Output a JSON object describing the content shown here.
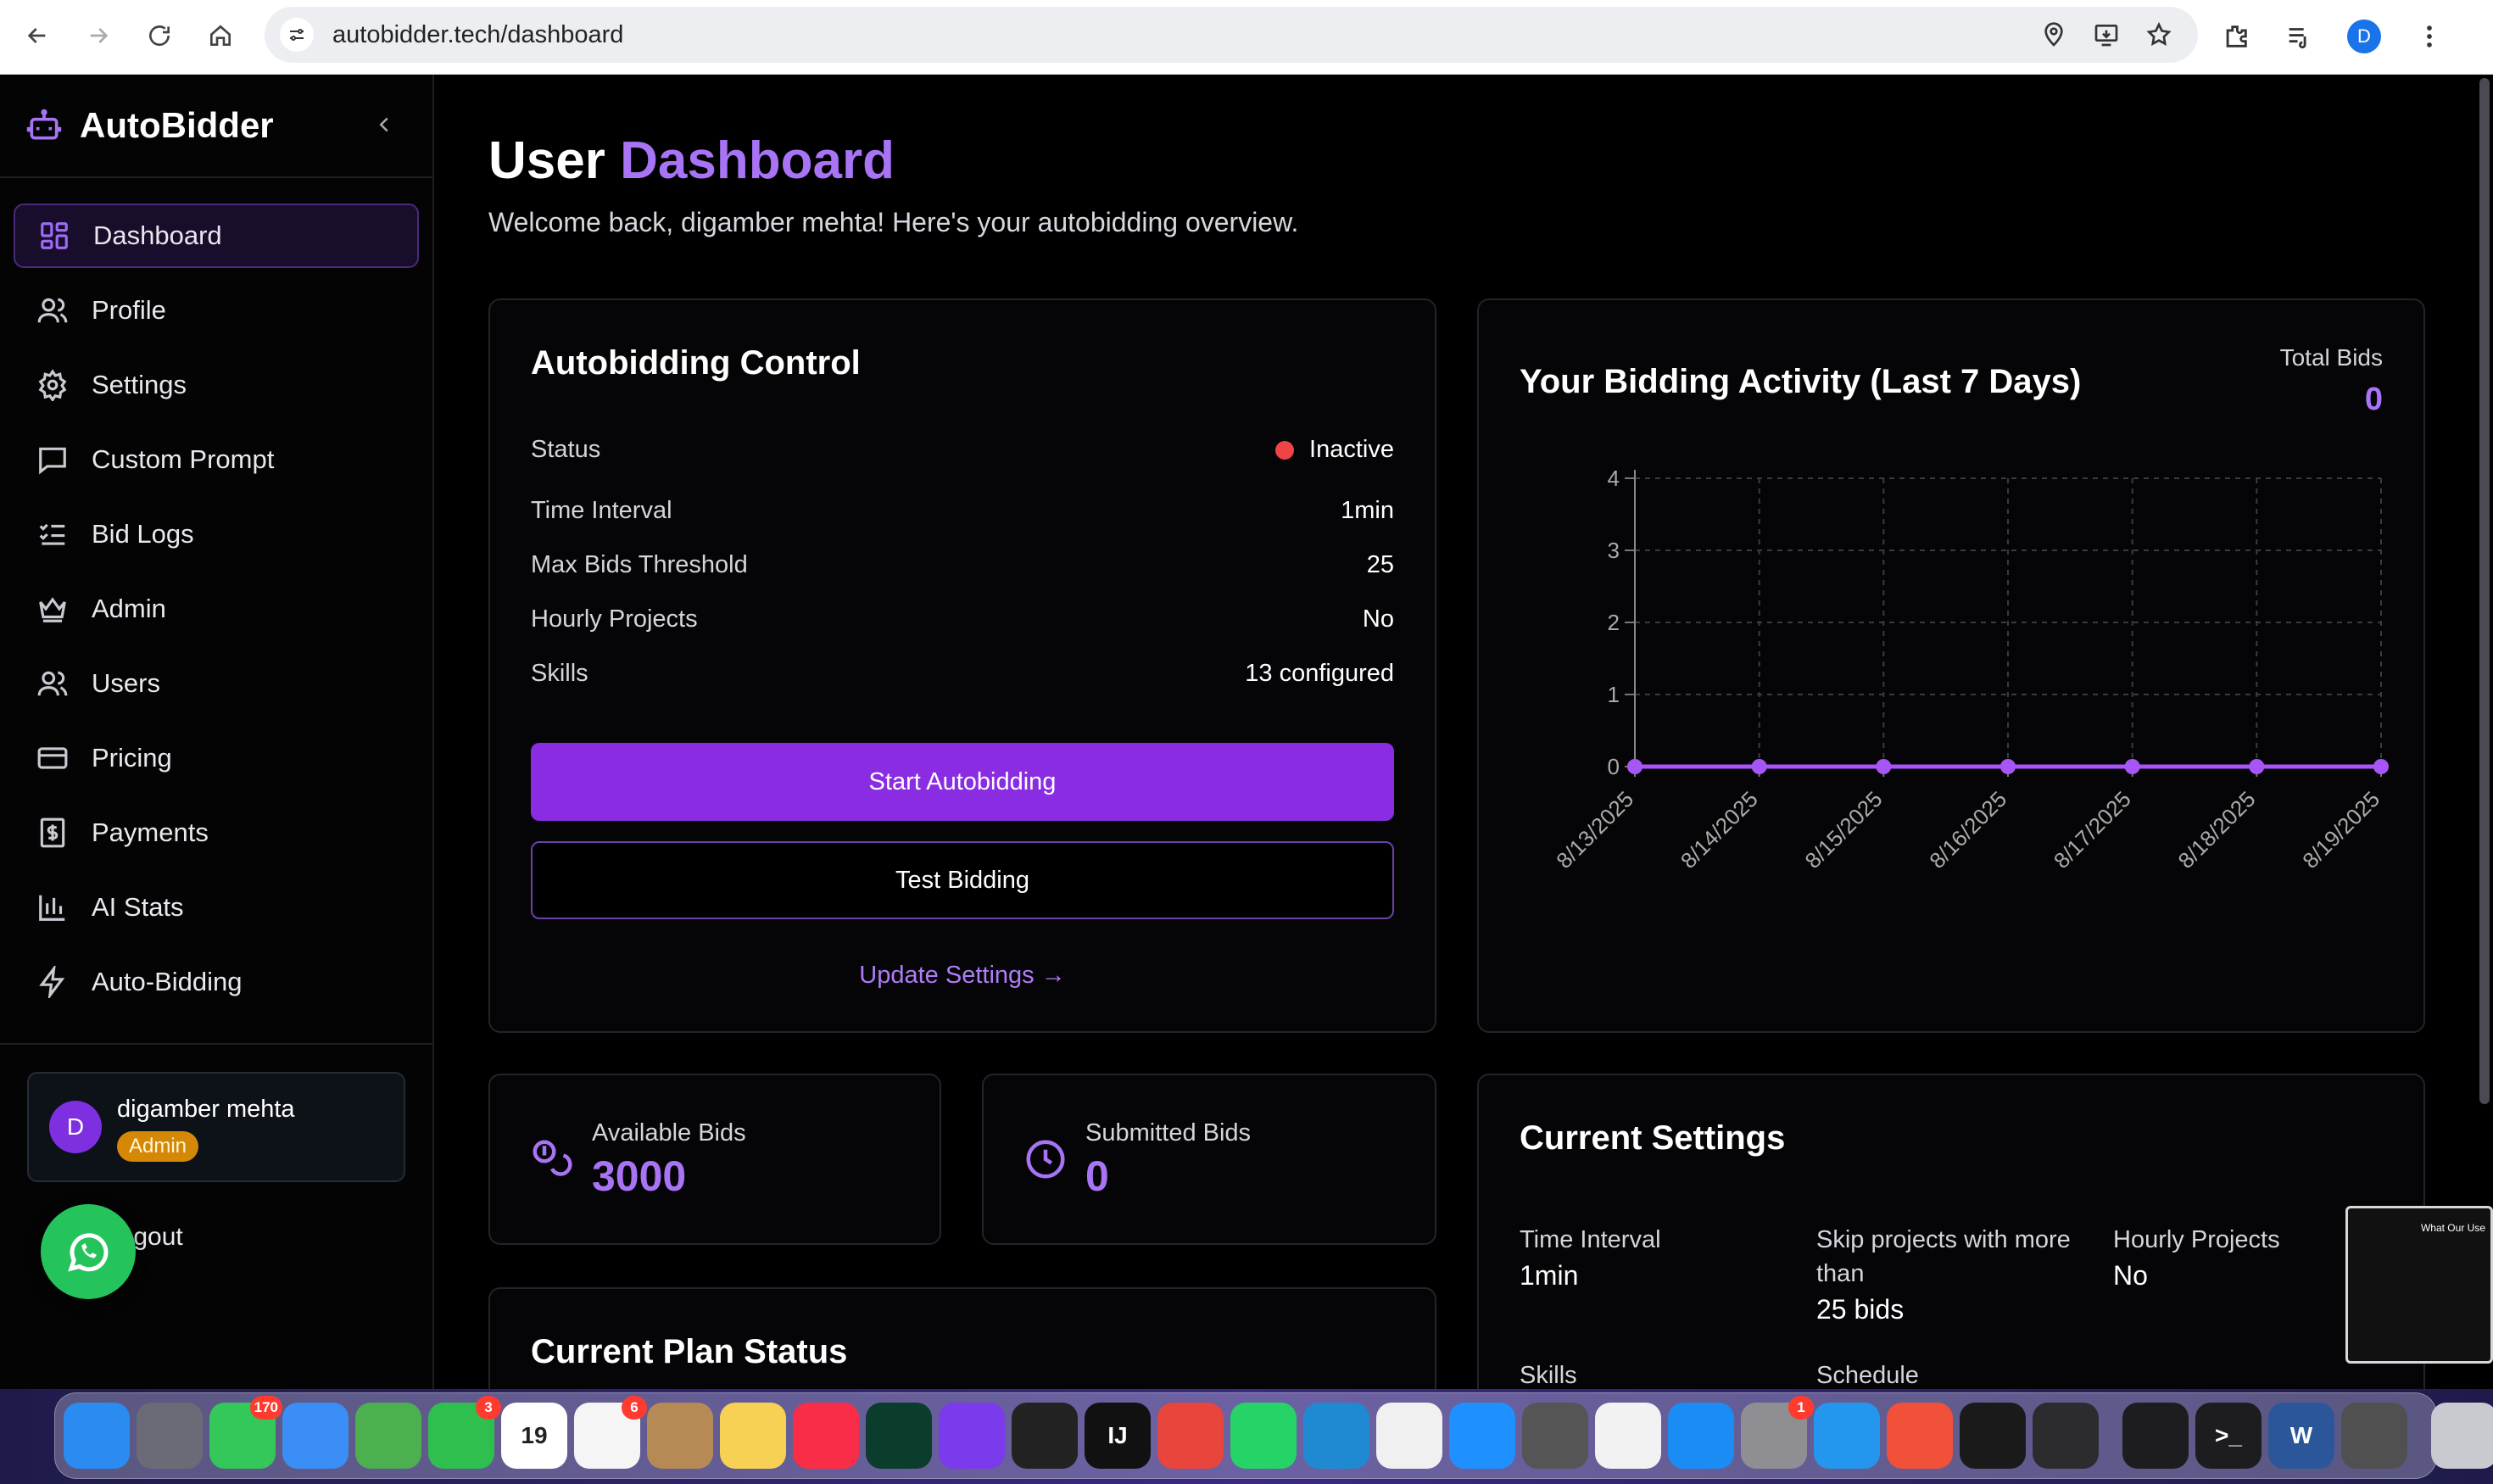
{
  "browser": {
    "url": "autobidder.tech/dashboard",
    "profile_initial": "D"
  },
  "sidebar": {
    "brand": "AutoBidder",
    "items": [
      {
        "label": "Dashboard",
        "icon": "dashboard-icon"
      },
      {
        "label": "Profile",
        "icon": "profile-icon"
      },
      {
        "label": "Settings",
        "icon": "gear-icon"
      },
      {
        "label": "Custom Prompt",
        "icon": "message-square-icon"
      },
      {
        "label": "Bid Logs",
        "icon": "list-checks-icon"
      },
      {
        "label": "Admin",
        "icon": "crown-icon"
      },
      {
        "label": "Users",
        "icon": "users-icon"
      },
      {
        "label": "Pricing",
        "icon": "credit-card-icon"
      },
      {
        "label": "Payments",
        "icon": "dollar-receipt-icon"
      },
      {
        "label": "AI Stats",
        "icon": "bar-chart-icon"
      },
      {
        "label": "Auto-Bidding",
        "icon": "lightning-icon"
      }
    ],
    "user": {
      "initial": "D",
      "name": "digamber mehta",
      "role": "Admin"
    },
    "logout": "Logout"
  },
  "main": {
    "title_prefix": "User",
    "title_accent": "Dashboard",
    "welcome": "Welcome back, digamber mehta! Here's your autobidding overview."
  },
  "control": {
    "title": "Autobidding Control",
    "rows": [
      {
        "label": "Status",
        "value": "Inactive"
      },
      {
        "label": "Time Interval",
        "value": "1min"
      },
      {
        "label": "Max Bids Threshold",
        "value": "25"
      },
      {
        "label": "Hourly Projects",
        "value": "No"
      },
      {
        "label": "Skills",
        "value": "13 configured"
      }
    ],
    "start_button": "Start Autobidding",
    "test_button": "Test Bidding",
    "update_link": "Update Settings →"
  },
  "activity": {
    "title": "Your Bidding Activity (Last 7 Days)",
    "total_label": "Total Bids",
    "total_value": "0"
  },
  "chart_data": {
    "type": "line",
    "title": "Your Bidding Activity (Last 7 Days)",
    "categories": [
      "8/13/2025",
      "8/14/2025",
      "8/15/2025",
      "8/16/2025",
      "8/17/2025",
      "8/18/2025",
      "8/19/2025"
    ],
    "values": [
      0,
      0,
      0,
      0,
      0,
      0,
      0
    ],
    "ylim": [
      0,
      4
    ],
    "yticks": [
      0,
      1,
      2,
      3,
      4
    ],
    "grid": true,
    "line_color": "#a855f7"
  },
  "stats": {
    "available": {
      "label": "Available Bids",
      "value": "3000"
    },
    "submitted": {
      "label": "Submitted Bids",
      "value": "0"
    }
  },
  "plan": {
    "title": "Current Plan Status"
  },
  "current_settings": {
    "title": "Current Settings",
    "time_interval_label": "Time Interval",
    "time_interval_value": "1min",
    "skip_label": "Skip projects with more than",
    "skip_value": "25 bids",
    "hourly_label": "Hourly Projects",
    "hourly_value": "No",
    "skills_label": "Skills",
    "schedule_label": "Schedule"
  },
  "thumbnail": {
    "text": "What Our Use"
  },
  "dock": {
    "apps": [
      {
        "name": "finder",
        "label": "",
        "color": "#2a8cf0"
      },
      {
        "name": "launchpad",
        "label": "",
        "color": "#6b6b78"
      },
      {
        "name": "messages",
        "label": "",
        "color": "#34c759",
        "badge": "170"
      },
      {
        "name": "mail",
        "label": "",
        "color": "#3b8ef5"
      },
      {
        "name": "maps",
        "label": "",
        "color": "#4caf50"
      },
      {
        "name": "facetime",
        "label": "",
        "color": "#2fbf4f",
        "badge": "3"
      },
      {
        "name": "calendar",
        "label": "19",
        "color": "#ffffff"
      },
      {
        "name": "reminders",
        "label": "",
        "color": "#f5f5f5",
        "badge": "6"
      },
      {
        "name": "contacts",
        "label": "",
        "color": "#b58a55"
      },
      {
        "name": "notes",
        "label": "",
        "color": "#f7d154"
      },
      {
        "name": "music",
        "label": "",
        "color": "#fa2d48"
      },
      {
        "name": "mongodb",
        "label": "",
        "color": "#0b3d2c"
      },
      {
        "name": "ghost",
        "label": "",
        "color": "#7c3aed"
      },
      {
        "name": "cube",
        "label": "",
        "color": "#222"
      },
      {
        "name": "intellij",
        "label": "IJ",
        "color": "#111"
      },
      {
        "name": "chrome",
        "label": "",
        "color": "#e8453c"
      },
      {
        "name": "whatsapp",
        "label": "",
        "color": "#25d366"
      },
      {
        "name": "vscode",
        "label": "",
        "color": "#1f8ad2"
      },
      {
        "name": "freeform",
        "label": "",
        "color": "#f0f0f0"
      },
      {
        "name": "safari",
        "label": "",
        "color": "#1e90ff"
      },
      {
        "name": "iphone-mirroring",
        "label": "",
        "color": "#555"
      },
      {
        "name": "chatgpt",
        "label": "",
        "color": "#f2f2f2"
      },
      {
        "name": "app-store",
        "label": "",
        "color": "#1c8cf5"
      },
      {
        "name": "system-settings",
        "label": "",
        "color": "#8e8e93",
        "badge": "1"
      },
      {
        "name": "docker",
        "label": "",
        "color": "#2496ed"
      },
      {
        "name": "swift-playgrounds",
        "label": "",
        "color": "#f05138"
      },
      {
        "name": "zed",
        "label": "",
        "color": "#1a1a1a"
      },
      {
        "name": "quicktime",
        "label": "",
        "color": "#2c2c2e"
      }
    ],
    "recent": [
      {
        "name": "activity-monitor",
        "label": "",
        "color": "#1d1d1f"
      },
      {
        "name": "terminal",
        "label": ">_",
        "color": "#1d1d1f"
      },
      {
        "name": "word",
        "label": "W",
        "color": "#2b579a"
      },
      {
        "name": "calculator",
        "label": "",
        "color": "#505050"
      }
    ],
    "trash": {
      "name": "trash",
      "label": "",
      "color": "#c9c9d0"
    }
  }
}
